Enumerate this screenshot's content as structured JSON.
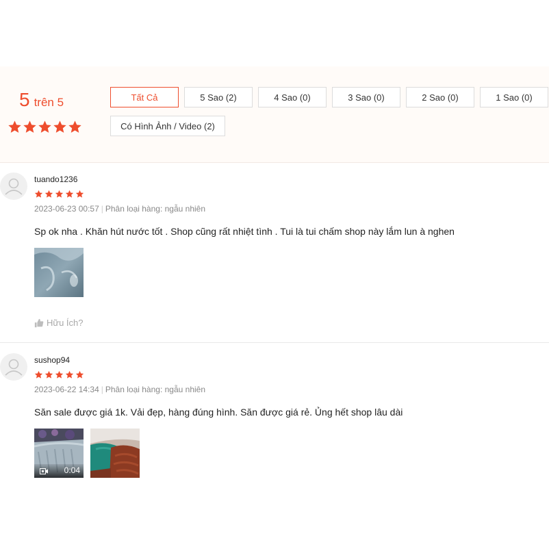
{
  "summary": {
    "score": "5",
    "score_suffix": "trên 5",
    "rating": 5
  },
  "filters": [
    {
      "label": "Tất Cả",
      "active": true
    },
    {
      "label": "5 Sao (2)",
      "active": false
    },
    {
      "label": "4 Sao (0)",
      "active": false
    },
    {
      "label": "3 Sao (0)",
      "active": false
    },
    {
      "label": "2 Sao (0)",
      "active": false
    },
    {
      "label": "1 Sao (0)",
      "active": false
    },
    {
      "label": "Có Hình Ảnh / Video (2)",
      "active": false
    }
  ],
  "reviews": [
    {
      "username": "tuando1236",
      "rating": 5,
      "datetime": "2023-06-23 00:57",
      "variant": "Phân loại hàng: ngẫu nhiên",
      "content": "Sp ok nha . Khăn hút nước tốt . Shop cũng rất nhiệt tình . Tui là tui chấm shop này lắm lun à nghen",
      "media_count": 1,
      "helpful_label": "Hữu Ích?"
    },
    {
      "username": "sushop94",
      "rating": 5,
      "datetime": "2023-06-22 14:34",
      "variant": "Phân loại hàng: ngẫu nhiên",
      "content": "Săn sale được giá 1k. Vải đẹp, hàng đúng hình. Săn được giá rẻ. Ủng hết shop lâu dài",
      "media_count": 2,
      "video_duration": "0:04"
    }
  ],
  "colors": {
    "accent": "#ee4d2d",
    "summary_bg": "#fffbf8",
    "meta_text": "#888888"
  },
  "icons": {
    "star": "star-icon",
    "avatar": "user-placeholder-icon",
    "helpful": "thumbs-up-icon",
    "video": "video-camera-icon"
  }
}
